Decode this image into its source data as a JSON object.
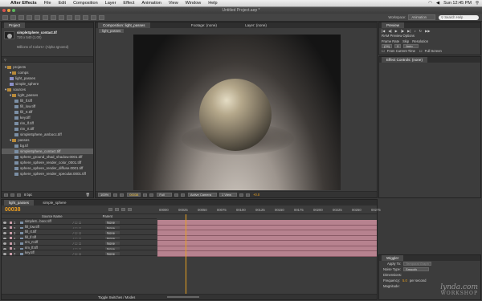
{
  "menubar": {
    "app_name": "After Effects",
    "items": [
      "File",
      "Edit",
      "Composition",
      "Layer",
      "Effect",
      "Animation",
      "View",
      "Window",
      "Help"
    ],
    "clock": "Sun 12:45 PM"
  },
  "window": {
    "title": "Untitled Project.aep *",
    "workspace_label": "Workspace:",
    "workspace_value": "Animation",
    "search_placeholder": "Search Help"
  },
  "project": {
    "tab": "Project",
    "selected_name": "simpleSphere_contact.tif",
    "selected_dims": "720 x 540 (1.00)",
    "selected_color": "Millions of Colors+ (Alpha Ignored)",
    "search_placeholder": "",
    "tree": [
      {
        "label": "projects",
        "kind": "folder",
        "indent": 0
      },
      {
        "label": "comps",
        "kind": "folder",
        "indent": 1
      },
      {
        "label": "light_passes",
        "kind": "comp",
        "indent": 1
      },
      {
        "label": "simple_sphere",
        "kind": "comp",
        "indent": 1
      },
      {
        "label": "sources",
        "kind": "folder",
        "indent": 0
      },
      {
        "label": "light_passes",
        "kind": "folder",
        "indent": 1
      },
      {
        "label": "fill_lf.tiff",
        "kind": "file",
        "indent": 2
      },
      {
        "label": "fill_low.tiff",
        "kind": "file",
        "indent": 2
      },
      {
        "label": "fill_rt.tiff",
        "kind": "file",
        "indent": 2
      },
      {
        "label": "key.tiff",
        "kind": "file",
        "indent": 2
      },
      {
        "label": "rim_lf.tiff",
        "kind": "file",
        "indent": 2
      },
      {
        "label": "rim_rt.tiff",
        "kind": "file",
        "indent": 2
      },
      {
        "label": "simpleSphere_ambocc.tiff",
        "kind": "file",
        "indent": 2
      },
      {
        "label": "passes",
        "kind": "folder",
        "indent": 1
      },
      {
        "label": "bg.tif",
        "kind": "file",
        "indent": 2
      },
      {
        "label": "simpleSphere_contact.tiff",
        "kind": "file",
        "indent": 2,
        "selected": true
      },
      {
        "label": "sphere_ground_shad_shadow.0001.tiff",
        "kind": "file",
        "indent": 2
      },
      {
        "label": "sphere_sphere_render_color_0001.tiff",
        "kind": "file",
        "indent": 2
      },
      {
        "label": "sphere_sphere_render_diffuse.0001.tiff",
        "kind": "file",
        "indent": 2
      },
      {
        "label": "sphere_sphere_render_specular.0001.tiff",
        "kind": "file",
        "indent": 2
      }
    ],
    "footer_bpc": "8 bpc"
  },
  "viewer": {
    "tabs": [
      "Composition: light_passes",
      "Footage: (none)",
      "Layer: (none)"
    ],
    "breadcrumb": "light_passes",
    "zoom": "100%",
    "timecode": "00038",
    "resolution": "Full",
    "camera": "Active Camera",
    "views": "1 View",
    "exposure": "+0.0"
  },
  "preview": {
    "tab": "Preview",
    "ram_options": "RAM Preview Options",
    "frame_rate_label": "Frame Rate",
    "skip_label": "Skip",
    "resolution_label": "Resolution",
    "frame_rate_value": "(24)",
    "skip_value": "0",
    "resolution_value": "Auto",
    "from_current": "From Current Time",
    "full_screen": "Full Screen"
  },
  "effect_controls": {
    "tab": "Effect Controls: (none)"
  },
  "timeline": {
    "tabs": [
      "light_passes",
      "simple_sphere"
    ],
    "timecode": "00038",
    "column_source": "Source Name",
    "column_parent": "Parent",
    "ruler": [
      "00000",
      "00025",
      "00050",
      "00075",
      "00100",
      "00125",
      "00150",
      "00175",
      "00200",
      "00225",
      "00250",
      "00275"
    ],
    "layers": [
      {
        "num": "1",
        "name": "simpleS...bocc.tiff",
        "parent": "None"
      },
      {
        "num": "2",
        "name": "fill_low.tiff",
        "parent": "None"
      },
      {
        "num": "3",
        "name": "fill_rt.tiff",
        "parent": "None"
      },
      {
        "num": "4",
        "name": "fill_lf.tiff",
        "parent": "None"
      },
      {
        "num": "5",
        "name": "rim_rt.tiff",
        "parent": "None"
      },
      {
        "num": "6",
        "name": "rim_lf.tiff",
        "parent": "None"
      },
      {
        "num": "7",
        "name": "key.tiff",
        "parent": "None"
      }
    ],
    "toggle_label": "Toggle Switches / Modes"
  },
  "wiggler": {
    "tab": "Wiggler",
    "apply_to_label": "Apply To:",
    "apply_to_value": "Temporal Graph",
    "noise_label": "Noise Type:",
    "noise_value": "Smooth",
    "dimensions_label": "Dimensions:",
    "frequency_label": "Frequency:",
    "frequency_value": "5.0",
    "frequency_unit": "per second",
    "magnitude_label": "Magnitude:"
  },
  "watermark": {
    "line1": "lynda.com",
    "line2": "WORKSHOP"
  },
  "colors": {
    "timeline_bar": "#b7828f",
    "accent": "#e8a020"
  }
}
